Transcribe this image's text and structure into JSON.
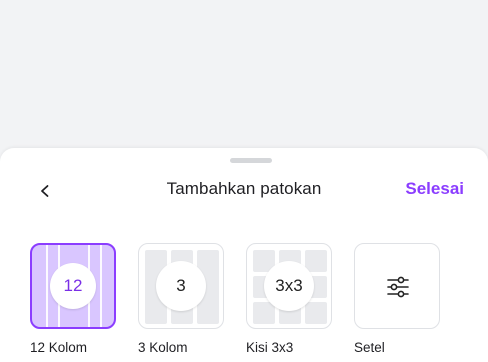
{
  "sheet": {
    "title": "Tambahkan patokan",
    "done_label": "Selesai",
    "back_icon": "chevron-left-icon"
  },
  "options": [
    {
      "badge": "12",
      "label": "12 Kolom",
      "selected": true
    },
    {
      "badge": "3",
      "label": "3 Kolom",
      "selected": false
    },
    {
      "badge": "3x3",
      "label": "Kisi 3x3",
      "selected": false
    },
    {
      "badge": "",
      "label": "Setel",
      "selected": false,
      "icon": "sliders-icon"
    }
  ],
  "colors": {
    "accent": "#8b3dff",
    "selected_fill": "#d9c6ff",
    "grid_fill": "#e9eaed"
  }
}
